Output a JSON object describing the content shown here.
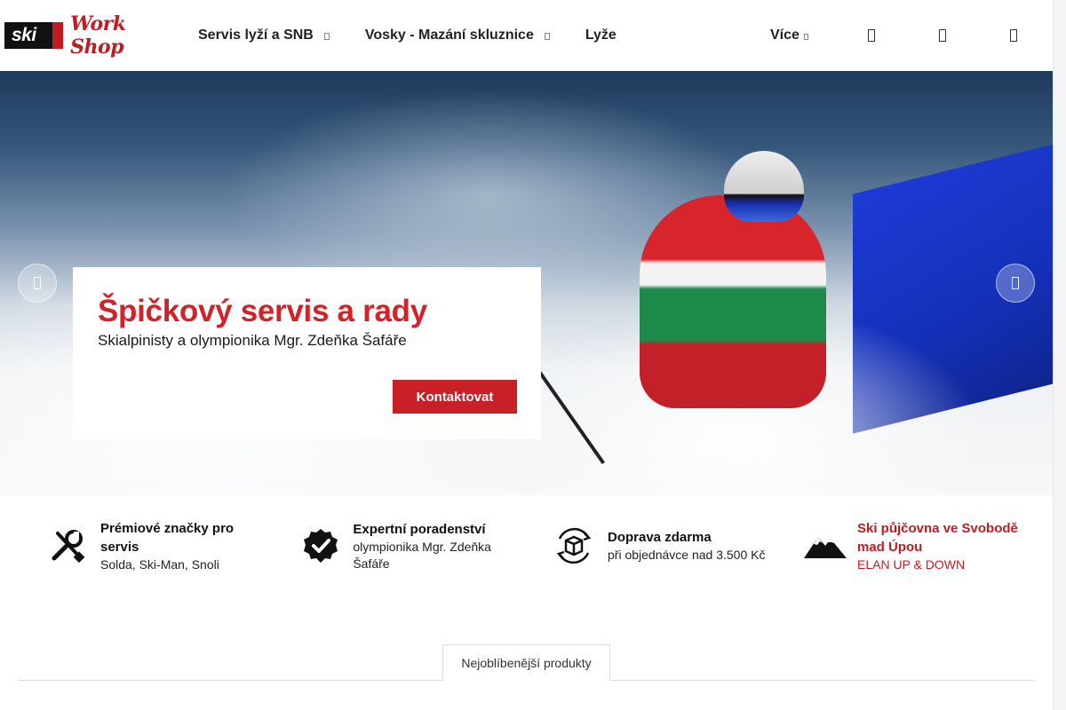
{
  "brand": {
    "logo_ski": "ski",
    "logo_workshop": "Work Shop"
  },
  "nav": {
    "items": [
      {
        "label": "Servis lyží a SNB",
        "has_dropdown": true
      },
      {
        "label": "Vosky - Mazání skluznice",
        "has_dropdown": true
      },
      {
        "label": "Lyže",
        "has_dropdown": false
      }
    ],
    "more_label": "Více"
  },
  "header_icons": [
    "search-icon",
    "user-icon",
    "cart-icon"
  ],
  "hero": {
    "title": "Špičkový servis a rady",
    "subtitle": "Skialpinisty a olympionika Mgr. Zdeňka Šafáře",
    "cta": "Kontaktovat"
  },
  "features": [
    {
      "icon": "tools-icon",
      "title": "Prémiové značky pro servis",
      "subtitle": "Solda, Ski-Man, Snoli"
    },
    {
      "icon": "verified-badge-icon",
      "title": "Expertní poradenství",
      "subtitle": "olympionika Mgr. Zdeňka Šafáře"
    },
    {
      "icon": "delivery-box-icon",
      "title": "Doprava zdarma",
      "subtitle": "při objednávce nad 3.500 Kč"
    },
    {
      "icon": "mountain-icon",
      "title": "Ski půjčovna ve Svobodě mad Úpou",
      "subtitle": "ELAN UP & DOWN"
    }
  ],
  "tabs": {
    "active": "Nejoblíbenější produkty"
  },
  "colors": {
    "brand_red": "#c21c23",
    "text_dark": "#111111"
  }
}
